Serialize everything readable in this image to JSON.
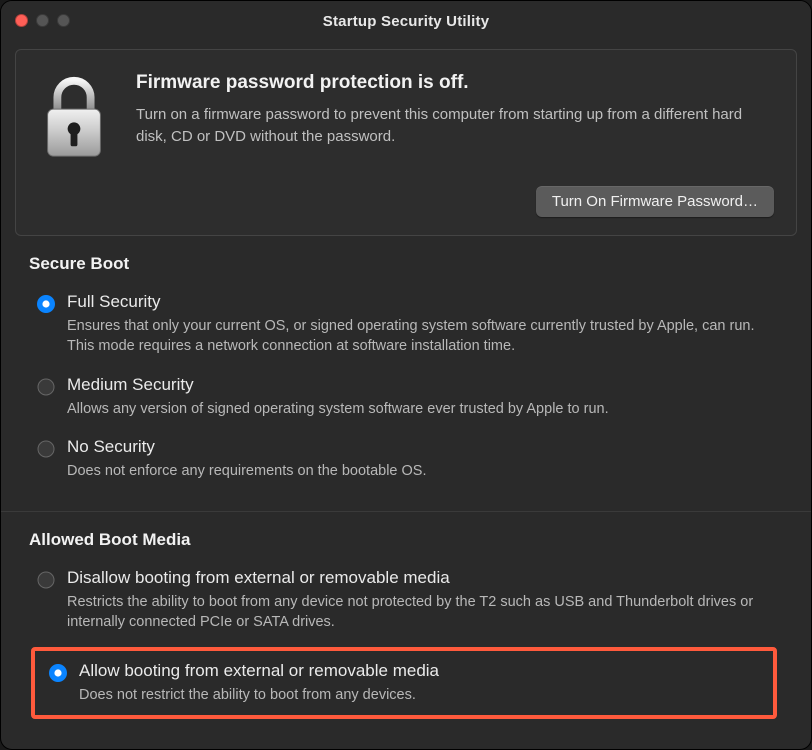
{
  "window": {
    "title": "Startup Security Utility"
  },
  "firmware": {
    "heading": "Firmware password protection is off.",
    "description": "Turn on a firmware password to prevent this computer from starting up from a different hard disk, CD or DVD without the password.",
    "button_label": "Turn On Firmware Password…"
  },
  "secure_boot": {
    "title": "Secure Boot",
    "options": [
      {
        "label": "Full Security",
        "description": "Ensures that only your current OS, or signed operating system software currently trusted by Apple, can run. This mode requires a network connection at software installation time.",
        "selected": true
      },
      {
        "label": "Medium Security",
        "description": "Allows any version of signed operating system software ever trusted by Apple to run.",
        "selected": false
      },
      {
        "label": "No Security",
        "description": "Does not enforce any requirements on the bootable OS.",
        "selected": false
      }
    ]
  },
  "boot_media": {
    "title": "Allowed Boot Media",
    "options": [
      {
        "label": "Disallow booting from external or removable media",
        "description": "Restricts the ability to boot from any device not protected by the T2 such as USB and Thunderbolt drives or internally connected PCIe or SATA drives.",
        "selected": false
      },
      {
        "label": "Allow booting from external or removable media",
        "description": "Does not restrict the ability to boot from any devices.",
        "selected": true
      }
    ]
  }
}
